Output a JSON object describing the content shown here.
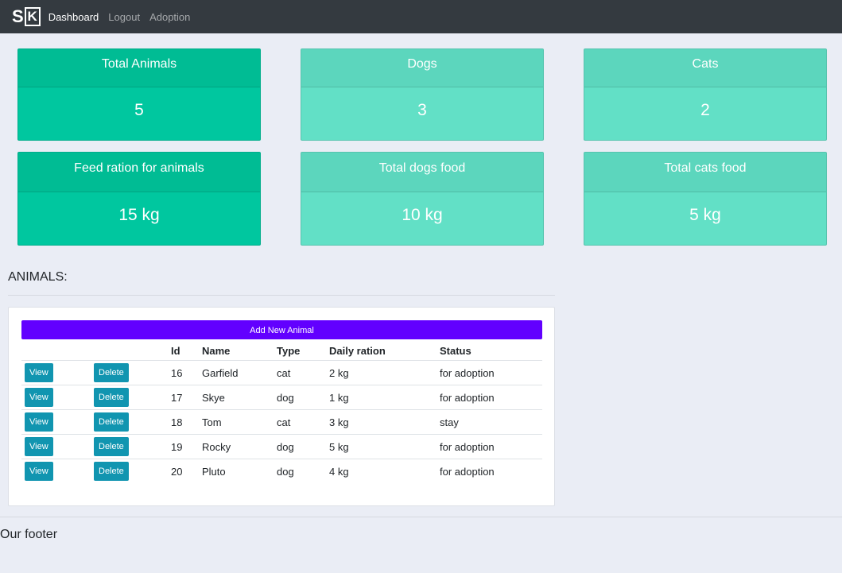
{
  "nav": {
    "logo_s": "S",
    "logo_k": "K",
    "links": [
      "Dashboard",
      "Logout",
      "Adoption"
    ]
  },
  "cards": [
    {
      "title": "Total Animals",
      "value": "5"
    },
    {
      "title": "Dogs",
      "value": "3"
    },
    {
      "title": "Cats",
      "value": "2"
    },
    {
      "title": "Feed ration for animals",
      "value": "15 kg"
    },
    {
      "title": "Total dogs food",
      "value": "10 kg"
    },
    {
      "title": "Total cats food",
      "value": "5 kg"
    }
  ],
  "animals": {
    "section_title": "ANIMALS:",
    "add_label": "Add New Animal",
    "view_label": "View",
    "delete_label": "Delete",
    "columns": [
      "Id",
      "Name",
      "Type",
      "Daily ration",
      "Status"
    ],
    "rows": [
      {
        "id": "16",
        "name": "Garfield",
        "type": "cat",
        "ration": "2 kg",
        "status": "for adoption"
      },
      {
        "id": "17",
        "name": "Skye",
        "type": "dog",
        "ration": "1 kg",
        "status": "for adoption"
      },
      {
        "id": "18",
        "name": "Tom",
        "type": "cat",
        "ration": "3 kg",
        "status": "stay"
      },
      {
        "id": "19",
        "name": "Rocky",
        "type": "dog",
        "ration": "5 kg",
        "status": "for adoption"
      },
      {
        "id": "20",
        "name": "Pluto",
        "type": "dog",
        "ration": "4 kg",
        "status": "for adoption"
      }
    ]
  },
  "footer": {
    "text": "Our footer"
  },
  "colors": {
    "navbar": "#343a40",
    "card_dark": "#00c79f",
    "card_light": "#62e0c6",
    "add_button": "#6200ff",
    "action_button": "#1195b0"
  }
}
